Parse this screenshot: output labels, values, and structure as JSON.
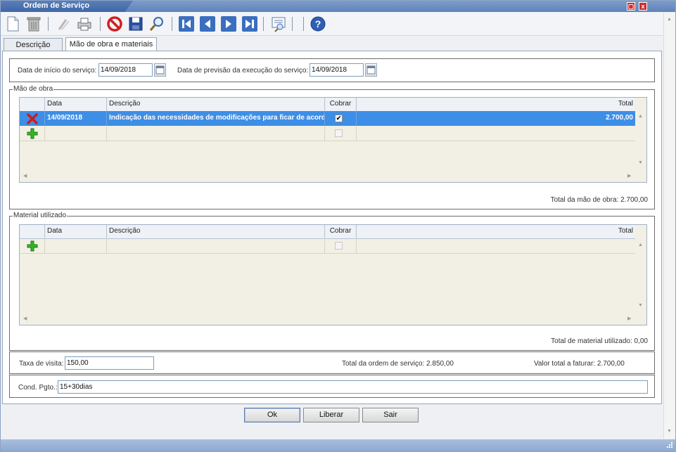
{
  "window": {
    "title": "Ordem de Serviço",
    "minimize_glyph": "▢",
    "close_glyph": "x"
  },
  "toolbar": {
    "icons": [
      "new-document-icon",
      "trash-icon",
      "attach-icon",
      "print-icon",
      "cancel-icon",
      "save-icon",
      "search-icon",
      "first-icon",
      "previous-icon",
      "next-icon",
      "last-icon",
      "report-icon",
      "help-icon"
    ]
  },
  "tabs": [
    {
      "label": "Descrição",
      "active": false
    },
    {
      "label": "Mão de obra e materiais",
      "active": true
    }
  ],
  "dates": {
    "inicio_label": "Data de início do serviço:",
    "inicio_value": "14/09/2018",
    "previsao_label": "Data de previsão da execução do serviço:",
    "previsao_value": "14/09/2018"
  },
  "mao_de_obra": {
    "legend": "Mão de obra",
    "columns": [
      "Data",
      "Descrição",
      "Cobrar",
      "Total"
    ],
    "rows": [
      {
        "data": "14/09/2018",
        "descricao": "Indicação das necessidades de modificações para ficar de acord…",
        "cobrar": "✔",
        "total": "2.700,00"
      }
    ],
    "total_label": "Total da mão de obra: 2.700,00"
  },
  "material": {
    "legend": "Material utilizado",
    "columns": [
      "Data",
      "Descrição",
      "Cobrar",
      "Total"
    ],
    "total_label": "Total de material utilizado: 0,00"
  },
  "resumo": {
    "taxa_label": "Taxa de visita:",
    "taxa_value": "150,00",
    "total_ordem": "Total da ordem de serviço: 2.850,00",
    "valor_faturar": "Valor total a faturar: 2.700,00"
  },
  "pagamento": {
    "label": "Cond. Pgto.:",
    "value": "15+30dias"
  },
  "buttons": {
    "ok": "Ok",
    "liberar": "Liberar",
    "sair": "Sair"
  },
  "colors": {
    "title_bar": "#5f83bb",
    "selected_row": "#3d8ee6",
    "close_button": "#d12b2b"
  }
}
